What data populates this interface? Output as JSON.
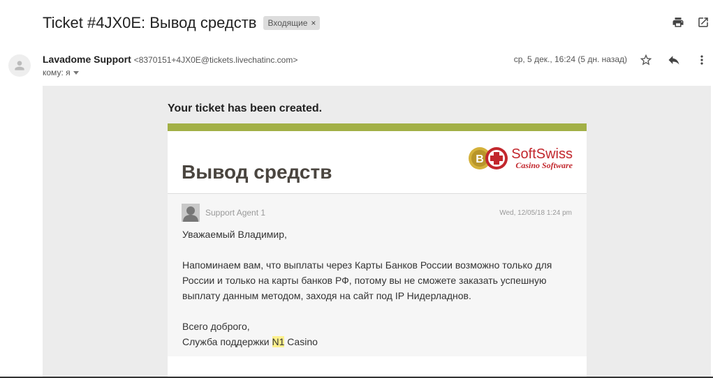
{
  "subject": "Ticket #4JX0E: Вывод средств",
  "label": {
    "text": "Входящие",
    "close": "×"
  },
  "sender": {
    "name": "Lavadome Support",
    "email": "<8370151+4JX0E@tickets.livechatinc.com>",
    "to": "кому: я",
    "date": "ср, 5 дек., 16:24 (5 дн. назад)"
  },
  "icons": {
    "print": "printer-icon",
    "open_new": "open-in-new-window-icon",
    "star": "star-icon",
    "reply": "reply-icon",
    "more": "more-vertical-icon",
    "avatar": "person-icon"
  },
  "email": {
    "created": "Your ticket has been created.",
    "title": "Вывод средств",
    "logo": {
      "main": "SoftSwiss",
      "sub": "Casino Software"
    },
    "agent": "Support Agent 1",
    "msg_date": "Wed, 12/05/18 1:24 pm",
    "greeting": "Уважаемый Владимир,",
    "paragraph": "Напоминаем вам, что выплаты через Карты Банков России возможно только для России и только на карты банков РФ, потому вы не сможете заказать успешную выплату данным методом, заходя на сайт под IP Нидерладнов.",
    "closing": "Всего доброго,",
    "signature_prefix": "Служба поддержки ",
    "signature_highlight": "N1",
    "signature_suffix": " Casino"
  },
  "colors": {
    "stripe": "#a2b046",
    "brand": "#c2272d",
    "background": "#ececec"
  }
}
